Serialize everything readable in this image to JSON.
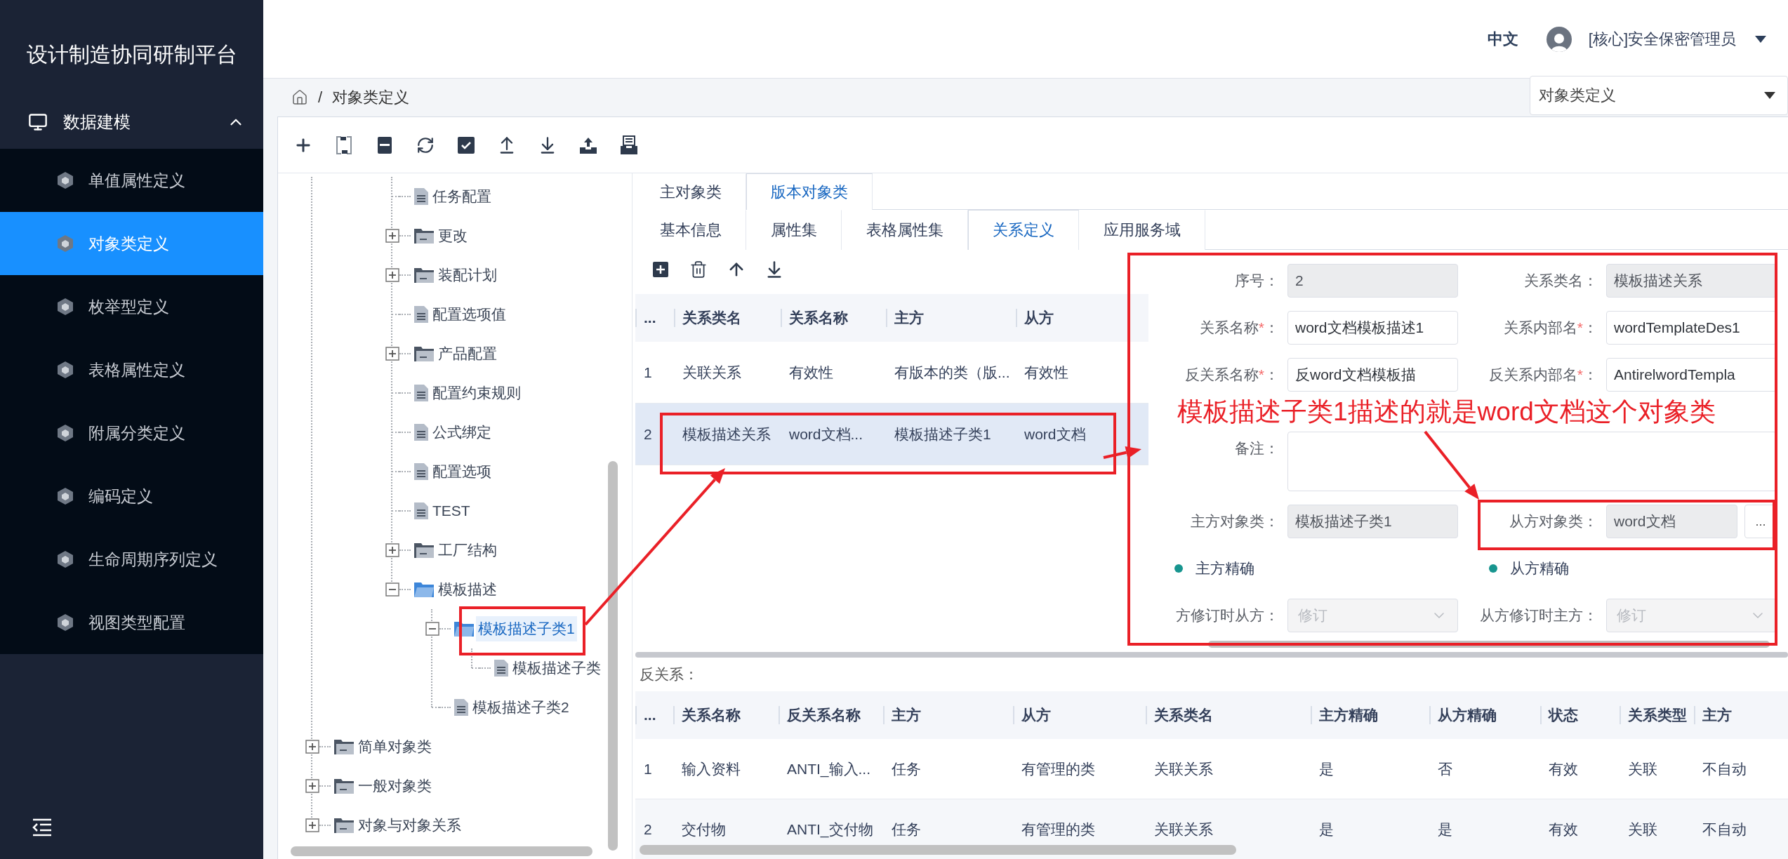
{
  "sidebar": {
    "title": "设计制造协同研制平台",
    "section": {
      "label": "数据建模",
      "expanded": true
    },
    "items": [
      {
        "label": "单值属性定义",
        "selected": false
      },
      {
        "label": "对象类定义",
        "selected": true
      },
      {
        "label": "枚举型定义",
        "selected": false
      },
      {
        "label": "表格属性定义",
        "selected": false
      },
      {
        "label": "附属分类定义",
        "selected": false
      },
      {
        "label": "编码定义",
        "selected": false
      },
      {
        "label": "生命周期序列定义",
        "selected": false
      },
      {
        "label": "视图类型配置",
        "selected": false
      }
    ]
  },
  "header": {
    "language": {
      "label": "中文",
      "selected": true
    },
    "user": "[核心]安全保密管理员"
  },
  "breadcrumb": {
    "separator": "/",
    "current": "对象类定义"
  },
  "page_select": {
    "value": "对象类定义"
  },
  "tree": {
    "items": [
      {
        "children": [
          {
            "children": [
              {
                "kind": "leaf",
                "label": "任务配置",
                "selected": false
              },
              {
                "kind": "folder",
                "label": "更改",
                "expanded": false,
                "selected": false
              },
              {
                "kind": "folder",
                "label": "装配计划",
                "expanded": false,
                "selected": false
              },
              {
                "kind": "leaf",
                "label": "配置选项值",
                "selected": false
              },
              {
                "kind": "folder",
                "label": "产品配置",
                "expanded": false,
                "selected": false
              },
              {
                "kind": "leaf",
                "label": "配置约束规则",
                "selected": false
              },
              {
                "kind": "leaf",
                "label": "公式绑定",
                "selected": false
              },
              {
                "kind": "leaf",
                "label": "配置选项",
                "selected": false
              },
              {
                "kind": "leaf",
                "label": "TEST",
                "selected": false
              },
              {
                "kind": "folder",
                "label": "工厂结构",
                "expanded": false,
                "selected": false
              },
              {
                "kind": "folder",
                "label": "模板描述",
                "expanded": true,
                "selected": false,
                "children": [
                  {
                    "kind": "folder",
                    "label": "模板描述子类1",
                    "expanded": true,
                    "selected": true,
                    "children": [
                      {
                        "kind": "leaf",
                        "label": "模板描述子类",
                        "selected": false
                      }
                    ]
                  },
                  {
                    "kind": "leaf",
                    "label": "模板描述子类2",
                    "selected": false
                  }
                ]
              }
            ]
          }
        ]
      },
      {
        "kind": "folder",
        "label": "简单对象类",
        "expanded": false,
        "selected": false
      },
      {
        "kind": "folder",
        "label": "一般对象类",
        "expanded": false,
        "selected": false
      },
      {
        "kind": "folder",
        "label": "对象与对象关系",
        "expanded": false,
        "selected": false
      }
    ]
  },
  "object_tabs": [
    {
      "label": "主对象类",
      "selected": false
    },
    {
      "label": "版本对象类",
      "selected": true
    }
  ],
  "detail_tabs": [
    {
      "label": "基本信息",
      "selected": false
    },
    {
      "label": "属性集",
      "selected": false
    },
    {
      "label": "表格属性集",
      "selected": false
    },
    {
      "label": "关系定义",
      "selected": true
    },
    {
      "label": "应用服务域",
      "selected": false
    }
  ],
  "relations_table": {
    "columns": [
      "...",
      "关系类名",
      "关系名称",
      "主方",
      "从方"
    ],
    "rows": [
      {
        "cells": [
          "1",
          "关联关系",
          "有效性",
          "有版本的类（版...",
          "有效性"
        ],
        "selected": false
      },
      {
        "cells": [
          "2",
          "模板描述关系",
          "word文档...",
          "模板描述子类1",
          "word文档"
        ],
        "selected": true
      }
    ]
  },
  "relation_form": {
    "fields": [
      {
        "kind": "text",
        "label": "序号",
        "colon": "：",
        "value": "2",
        "readonly": true
      },
      {
        "kind": "text",
        "label": "关系类名",
        "colon": "：",
        "value": "模板描述关系",
        "readonly": true
      },
      {
        "kind": "text",
        "label": "关系名称",
        "required_mark": "*",
        "colon": "：",
        "value": "word文档模板描述1",
        "readonly": false
      },
      {
        "kind": "text",
        "label": "关系内部名",
        "required_mark": "*",
        "colon": "：",
        "value": "wordTemplateDes1",
        "readonly": false
      },
      {
        "kind": "text",
        "label": "反关系名称",
        "required_mark": "*",
        "colon": "：",
        "value": "反word文档模板描",
        "readonly": false
      },
      {
        "kind": "text",
        "label": "反关系内部名",
        "required_mark": "*",
        "colon": "：",
        "value": "AntirelwordTempla",
        "readonly": false
      },
      {
        "kind": "textarea",
        "label": "备注",
        "colon": "：",
        "readonly": false
      },
      {
        "kind": "text",
        "label": "主方对象类",
        "colon": "：",
        "value": "模板描述子类1",
        "readonly": true
      },
      {
        "kind": "picker",
        "label": "从方对象类",
        "colon": "：",
        "value": "word文档",
        "readonly": true,
        "button": "..."
      },
      {
        "kind": "check",
        "label": "主方精确",
        "checked": true
      },
      {
        "kind": "check",
        "label": "从方精确",
        "checked": true
      },
      {
        "kind": "select",
        "label": "方修订时从方",
        "colon": "：",
        "value": "修订",
        "disabled": true
      },
      {
        "kind": "select",
        "label": "从方修订时主方",
        "colon": "：",
        "value": "修订",
        "disabled": true
      }
    ]
  },
  "inverse_relations": {
    "title": "反关系：",
    "columns": [
      "...",
      "关系名称",
      "反关系名称",
      "主方",
      "从方",
      "关系类名",
      "主方精确",
      "从方精确",
      "状态",
      "关系类型",
      "主方"
    ],
    "rows": [
      {
        "cells": [
          "1",
          "输入资料",
          "ANTI_输入...",
          "任务",
          "有管理的类",
          "关联关系",
          "是",
          "否",
          "有效",
          "关联",
          "不自动"
        ]
      },
      {
        "cells": [
          "2",
          "交付物",
          "ANTI_交付物",
          "任务",
          "有管理的类",
          "关联关系",
          "是",
          "是",
          "有效",
          "关联",
          "不自动"
        ]
      }
    ]
  },
  "annotation": {
    "text": "模板描述子类1描述的就是word文档这个对象类"
  }
}
